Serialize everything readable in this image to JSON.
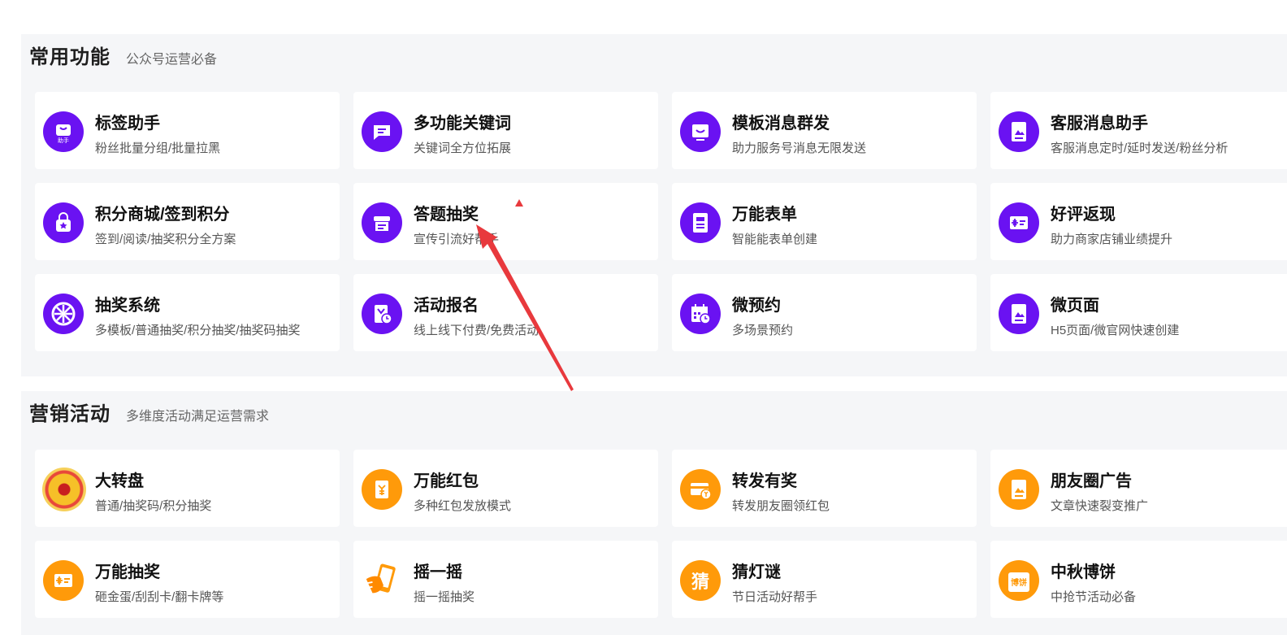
{
  "sections": [
    {
      "title": "常用功能",
      "subtitle": "公众号运营必备",
      "cards": [
        {
          "title": "标签助手",
          "desc": "粉丝批量分组/批量拉黑",
          "icon": "tag-helper-icon",
          "icon_text": "助手"
        },
        {
          "title": "多功能关键词",
          "desc": "关键词全方位拓展",
          "icon": "keyword-icon"
        },
        {
          "title": "模板消息群发",
          "desc": "助力服务号消息无限发送",
          "icon": "template-message-icon"
        },
        {
          "title": "客服消息助手",
          "desc": "客服消息定时/延时发送/粉丝分析",
          "icon": "customer-service-icon"
        },
        {
          "title": "积分商城/签到积分",
          "desc": "签到/阅读/抽奖积分全方案",
          "icon": "points-mall-icon"
        },
        {
          "title": "答题抽奖",
          "desc": "宣传引流好帮手",
          "icon": "quiz-lottery-icon"
        },
        {
          "title": "万能表单",
          "desc": "智能能表单创建",
          "icon": "form-icon"
        },
        {
          "title": "好评返现",
          "desc": "助力商家店铺业绩提升",
          "icon": "review-cashback-icon"
        },
        {
          "title": "抽奖系统",
          "desc": "多模板/普通抽奖/积分抽奖/抽奖码抽奖",
          "icon": "lottery-system-icon"
        },
        {
          "title": "活动报名",
          "desc": "线上线下付费/免费活动",
          "icon": "event-signup-icon"
        },
        {
          "title": "微预约",
          "desc": "多场景预约",
          "icon": "calendar-icon"
        },
        {
          "title": "微页面",
          "desc": "H5页面/微官网快速创建",
          "icon": "micro-page-icon"
        }
      ]
    },
    {
      "title": "营销活动",
      "subtitle": "多维度活动满足运营需求",
      "cards": [
        {
          "title": "大转盘",
          "desc": "普通/抽奖码/积分抽奖",
          "icon": "wheel-icon"
        },
        {
          "title": "万能红包",
          "desc": "多种红包发放模式",
          "icon": "red-packet-icon"
        },
        {
          "title": "转发有奖",
          "desc": "转发朋友圈领红包",
          "icon": "share-reward-icon"
        },
        {
          "title": "朋友圈广告",
          "desc": "文章快速裂变推广",
          "icon": "moments-ad-icon"
        },
        {
          "title": "万能抽奖",
          "desc": "砸金蛋/刮刮卡/翻卡牌等",
          "icon": "universal-lottery-icon"
        },
        {
          "title": "摇一摇",
          "desc": "摇一摇抽奖",
          "icon": "shake-icon"
        },
        {
          "title": "猜灯谜",
          "desc": "节日活动好帮手",
          "icon": "riddle-icon",
          "icon_text": "猜"
        },
        {
          "title": "中秋博饼",
          "desc": "中抢节活动必备",
          "icon": "mooncake-icon",
          "icon_text": "博饼"
        }
      ]
    }
  ],
  "colors": {
    "accent_purple": "#6a12f2",
    "accent_orange": "#ff9a0a",
    "annotation_red": "#e8393d"
  }
}
